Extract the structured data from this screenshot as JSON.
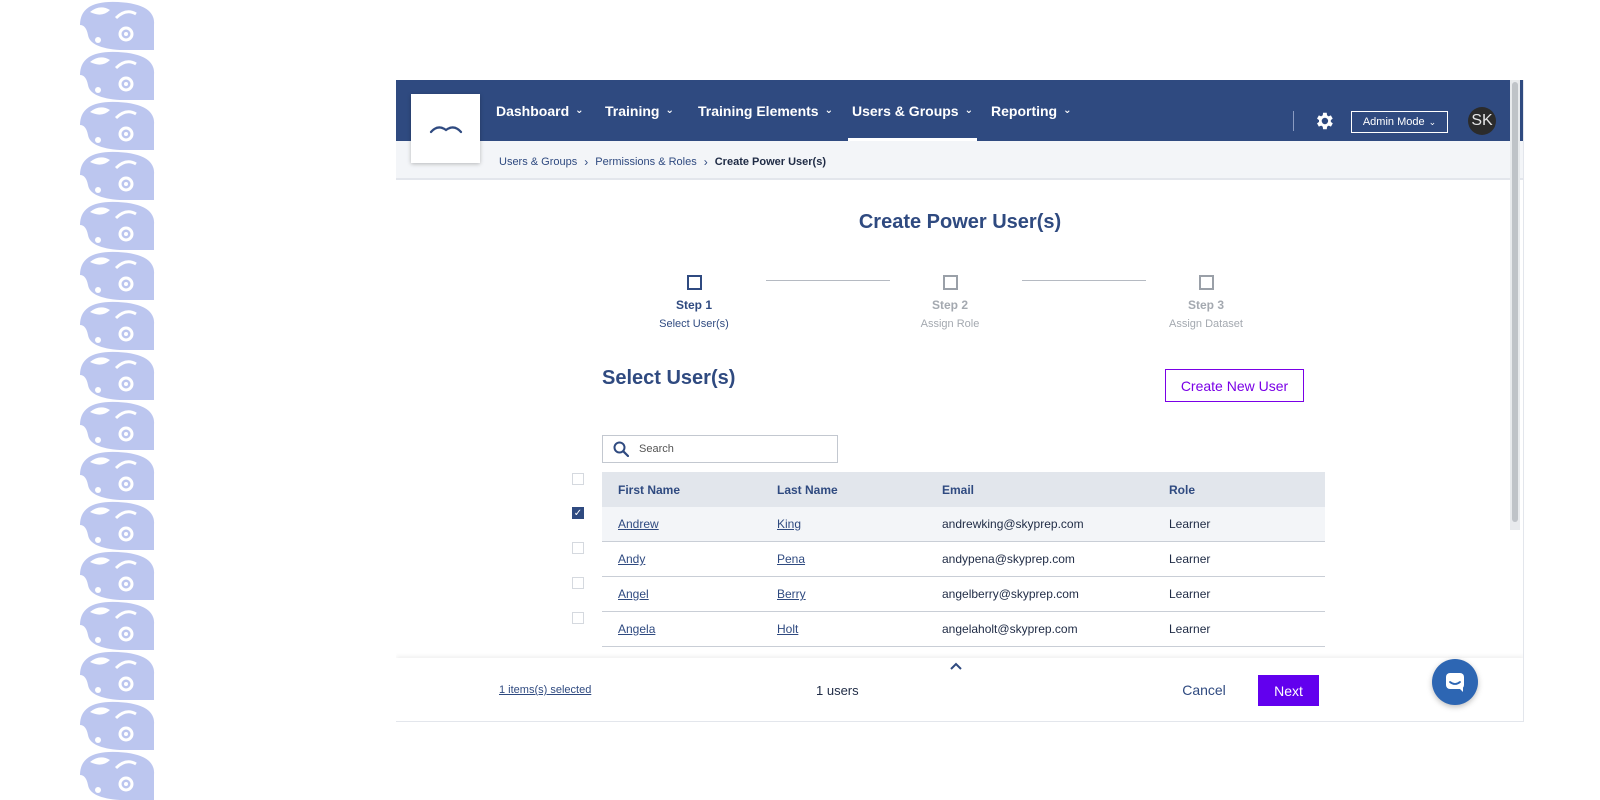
{
  "nav": {
    "items": [
      {
        "label": "Dashboard",
        "active": false
      },
      {
        "label": "Training",
        "active": false
      },
      {
        "label": "Training Elements",
        "active": false
      },
      {
        "label": "Users & Groups",
        "active": true
      },
      {
        "label": "Reporting",
        "active": false
      }
    ],
    "admin_mode": "Admin Mode",
    "avatar_initials": "SK"
  },
  "breadcrumb": {
    "items": [
      "Users & Groups",
      "Permissions & Roles"
    ],
    "current": "Create Power User(s)"
  },
  "page_title": "Create Power User(s)",
  "steps": [
    {
      "title": "Step 1",
      "subtitle": "Select User(s)",
      "active": true
    },
    {
      "title": "Step 2",
      "subtitle": "Assign Role",
      "active": false
    },
    {
      "title": "Step 3",
      "subtitle": "Assign Dataset",
      "active": false
    }
  ],
  "section_title": "Select User(s)",
  "create_new_user_label": "Create New User",
  "search": {
    "placeholder": "Search",
    "value": ""
  },
  "table": {
    "columns": [
      "First Name",
      "Last Name",
      "Email",
      "Role"
    ],
    "rows": [
      {
        "first": "Andrew",
        "last": "King",
        "email": "andrewking@skyprep.com",
        "role": "Learner",
        "checked": true
      },
      {
        "first": "Andy",
        "last": "Pena",
        "email": "andypena@skyprep.com",
        "role": "Learner",
        "checked": false
      },
      {
        "first": "Angel",
        "last": "Berry",
        "email": "angelberry@skyprep.com",
        "role": "Learner",
        "checked": false
      },
      {
        "first": "Angela",
        "last": "Holt",
        "email": "angelaholt@skyprep.com",
        "role": "Learner",
        "checked": false
      }
    ]
  },
  "footer": {
    "items_selected": "1 items(s) selected",
    "users_count": "1 users",
    "cancel_label": "Cancel",
    "next_label": "Next"
  },
  "colors": {
    "nav_bg": "#2f4a80",
    "accent_purple": "#6200ee",
    "pattern": "#bcc6ef"
  }
}
